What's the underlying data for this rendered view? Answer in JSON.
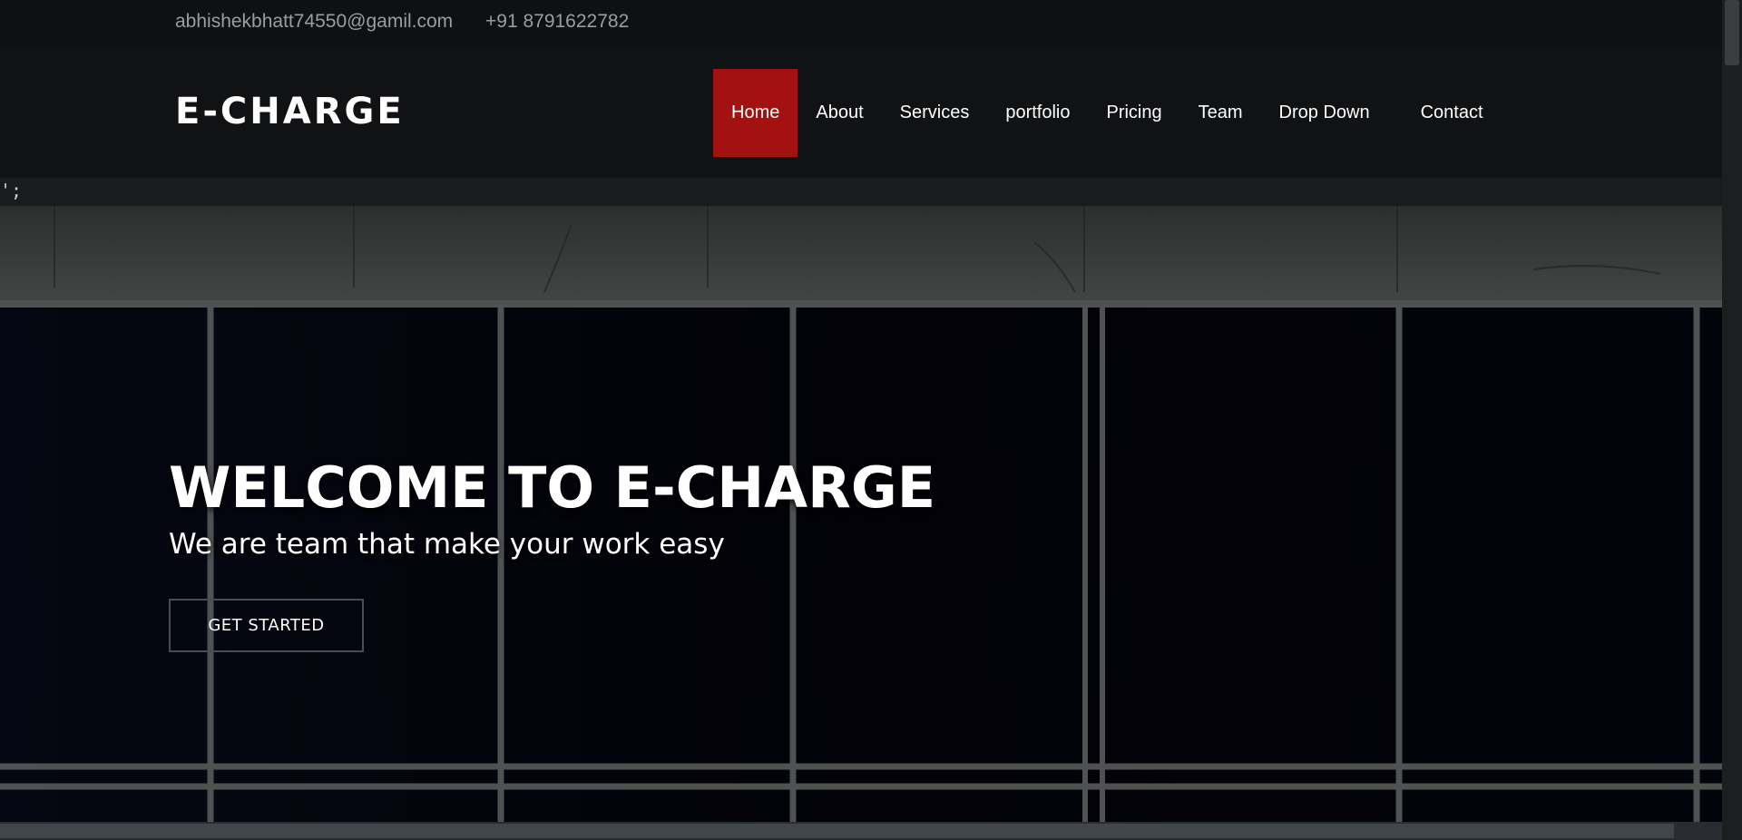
{
  "topbar": {
    "email": "abhishekbhatt74550@gamil.com",
    "phone": "+91 8791622782"
  },
  "header": {
    "logo": "E-CHARGE",
    "nav": [
      {
        "label": "Home",
        "active": true
      },
      {
        "label": "About"
      },
      {
        "label": "Services"
      },
      {
        "label": "portfolio"
      },
      {
        "label": "Pricing"
      },
      {
        "label": "Team"
      },
      {
        "label": "Drop Down"
      },
      {
        "label": "Contact"
      }
    ]
  },
  "stray_text": "';",
  "hero": {
    "title": "WELCOME TO E-CHARGE",
    "subtitle": "We are team that make your work easy",
    "cta_label": "GET STARTED"
  },
  "colors": {
    "accent": "#a31111",
    "background": "#0b0c0e"
  }
}
